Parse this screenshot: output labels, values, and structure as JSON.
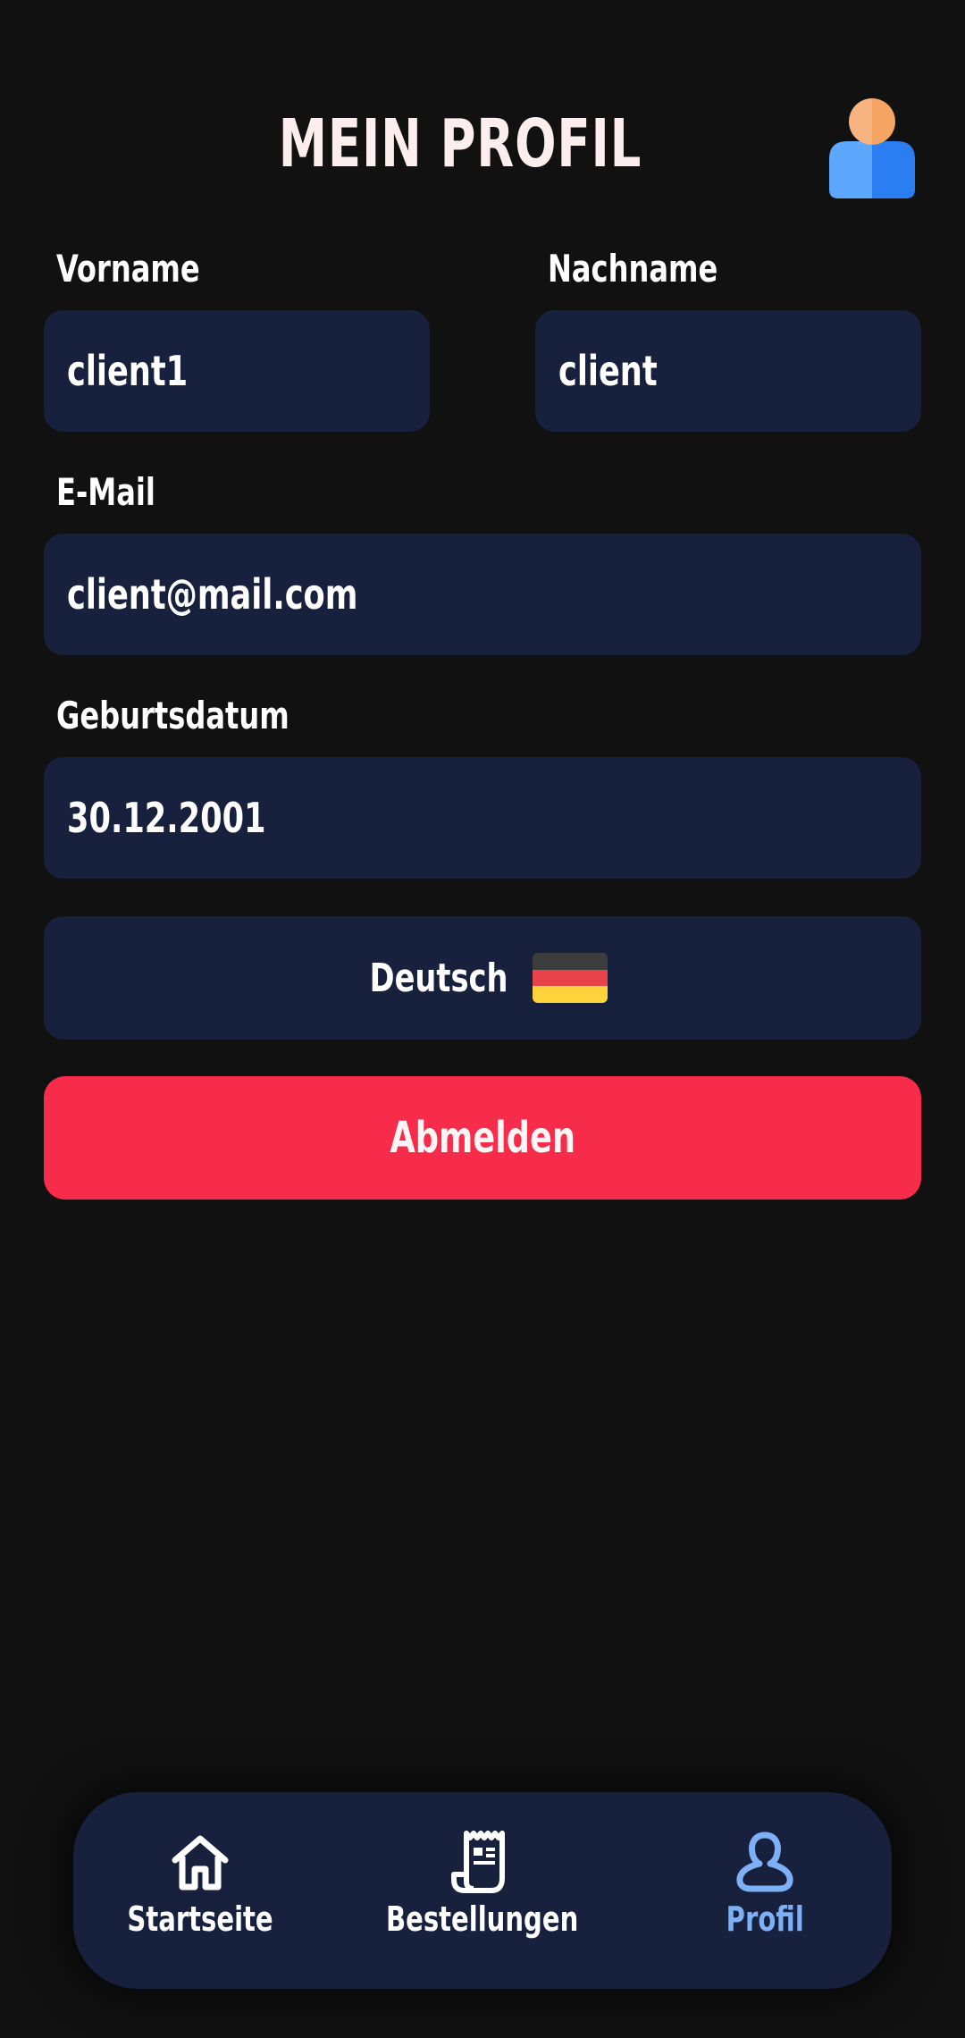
{
  "header": {
    "title": "MEIN PROFIL"
  },
  "form": {
    "first_name_label": "Vorname",
    "first_name_value": "client1",
    "last_name_label": "Nachname",
    "last_name_value": "client",
    "email_label": "E-Mail",
    "email_value": "client@mail.com",
    "birthdate_label": "Geburtsdatum",
    "birthdate_value": "30.12.2001"
  },
  "language": {
    "label": "Deutsch",
    "flag": "germany-flag-icon"
  },
  "logout": {
    "label": "Abmelden"
  },
  "bottom_nav": {
    "items": [
      {
        "label": "Startseite",
        "icon": "home-icon",
        "active": false
      },
      {
        "label": "Bestellungen",
        "icon": "receipt-icon",
        "active": false
      },
      {
        "label": "Profil",
        "icon": "user-icon",
        "active": true
      }
    ]
  },
  "colors": {
    "background": "#111111",
    "field": "#17203d",
    "logout": "#f72c4b",
    "active_nav": "#7db0f5"
  }
}
